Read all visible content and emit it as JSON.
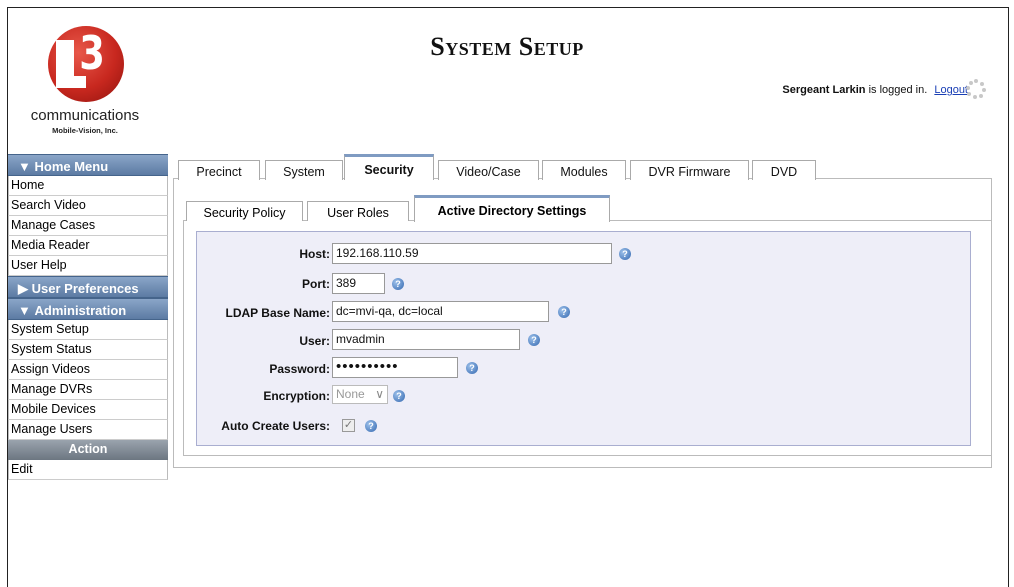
{
  "header": {
    "title": "System Setup",
    "logo_company": "communications",
    "logo_sub": "Mobile-Vision, Inc.",
    "user_name": "Sergeant Larkin",
    "logged_in_text": " is logged in.",
    "logout_label": "Logout"
  },
  "sidebar": {
    "home_menu": {
      "label": "Home Menu",
      "items": [
        "Home",
        "Search Video",
        "Manage Cases",
        "Media Reader",
        "User Help"
      ]
    },
    "user_prefs": {
      "label": "User Preferences"
    },
    "administration": {
      "label": "Administration",
      "items": [
        "System Setup",
        "System Status",
        "Assign Videos",
        "Manage DVRs",
        "Mobile Devices",
        "Manage Users"
      ]
    },
    "action": {
      "label": "Action",
      "items": [
        "Edit"
      ]
    }
  },
  "tabs": [
    "Precinct",
    "System",
    "Security",
    "Video/Case",
    "Modules",
    "DVR Firmware",
    "DVD"
  ],
  "active_tab": "Security",
  "subtabs": [
    "Security Policy",
    "User Roles",
    "Active Directory Settings"
  ],
  "active_subtab": "Active Directory Settings",
  "form": {
    "host_label": "Host:",
    "host_value": "192.168.110.59",
    "port_label": "Port:",
    "port_value": "389",
    "ldap_label": "LDAP Base Name:",
    "ldap_value": "dc=mvi-qa, dc=local",
    "user_label": "User:",
    "user_value": "mvadmin",
    "password_label": "Password:",
    "password_value": "••••••••••",
    "encryption_label": "Encryption:",
    "encryption_value": "None",
    "autocreate_label": "Auto Create Users:",
    "autocreate_checked": true
  }
}
